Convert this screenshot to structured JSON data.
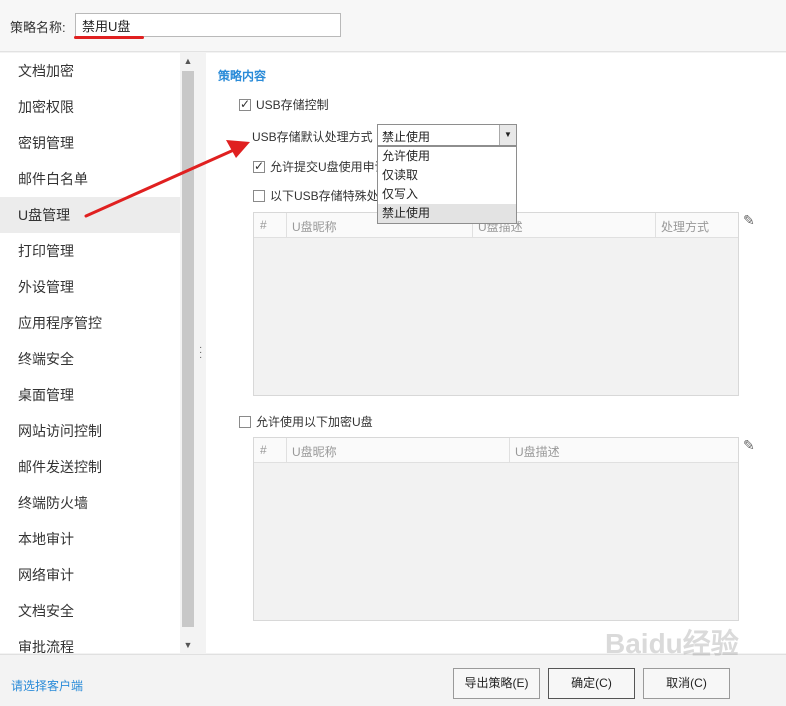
{
  "header": {
    "name_label": "策略名称:",
    "name_value": "禁用U盘"
  },
  "sidebar": {
    "items": [
      {
        "label": "文档加密"
      },
      {
        "label": "加密权限"
      },
      {
        "label": "密钥管理"
      },
      {
        "label": "邮件白名单"
      },
      {
        "label": "U盘管理"
      },
      {
        "label": "打印管理"
      },
      {
        "label": "外设管理"
      },
      {
        "label": "应用程序管控"
      },
      {
        "label": "终端安全"
      },
      {
        "label": "桌面管理"
      },
      {
        "label": "网站访问控制"
      },
      {
        "label": "邮件发送控制"
      },
      {
        "label": "终端防火墙"
      },
      {
        "label": "本地审计"
      },
      {
        "label": "网络审计"
      },
      {
        "label": "文档安全"
      },
      {
        "label": "审批流程"
      }
    ],
    "active_index": 4
  },
  "main": {
    "section_title": "策略内容",
    "usb_control": {
      "label": "USB存储控制",
      "checked": true
    },
    "default_mode": {
      "label": "USB存储默认处理方式",
      "value": "禁止使用"
    },
    "dropdown_options": [
      "允许使用",
      "仅读取",
      "仅写入",
      "禁止使用"
    ],
    "allow_apply": {
      "label": "允许提交U盘使用申请",
      "checked": true
    },
    "special_usb": {
      "label": "以下USB存储特殊处理",
      "checked": false
    },
    "table1": {
      "headers": [
        "#",
        "U盘昵称",
        "U盘描述",
        "处理方式"
      ]
    },
    "encrypted_usb": {
      "label": "允许使用以下加密U盘",
      "checked": false
    },
    "table2": {
      "headers": [
        "#",
        "U盘昵称",
        "U盘描述"
      ]
    }
  },
  "footer": {
    "client_link": "请选择客户端",
    "export_button": "导出策略(E)",
    "ok_button": "确定(C)",
    "cancel_button": "取消(C)"
  },
  "watermark": "Baidu经验"
}
